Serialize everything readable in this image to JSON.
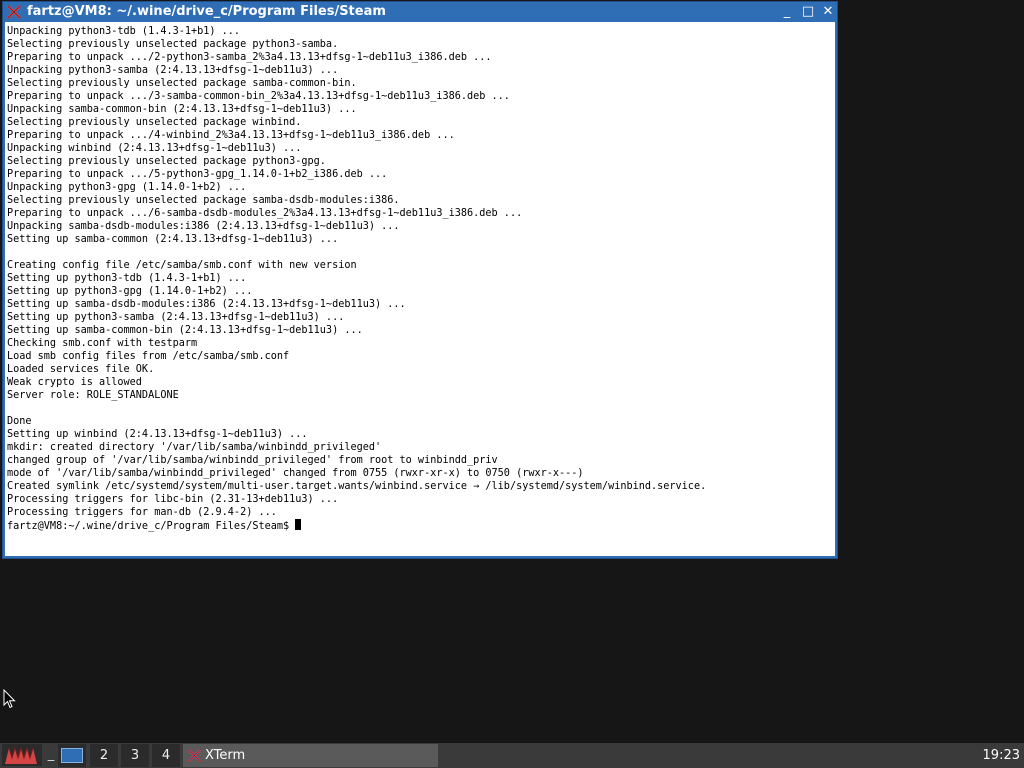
{
  "window": {
    "title": "fartz@VM8: ~/.wine/drive_c/Program Files/Steam",
    "buttons": {
      "minimize": "_",
      "maximize": "□",
      "close": "✕"
    }
  },
  "terminal": {
    "lines": [
      "Unpacking python3-tdb (1.4.3-1+b1) ...",
      "Selecting previously unselected package python3-samba.",
      "Preparing to unpack .../2-python3-samba_2%3a4.13.13+dfsg-1~deb11u3_i386.deb ...",
      "Unpacking python3-samba (2:4.13.13+dfsg-1~deb11u3) ...",
      "Selecting previously unselected package samba-common-bin.",
      "Preparing to unpack .../3-samba-common-bin_2%3a4.13.13+dfsg-1~deb11u3_i386.deb ...",
      "Unpacking samba-common-bin (2:4.13.13+dfsg-1~deb11u3) ...",
      "Selecting previously unselected package winbind.",
      "Preparing to unpack .../4-winbind_2%3a4.13.13+dfsg-1~deb11u3_i386.deb ...",
      "Unpacking winbind (2:4.13.13+dfsg-1~deb11u3) ...",
      "Selecting previously unselected package python3-gpg.",
      "Preparing to unpack .../5-python3-gpg_1.14.0-1+b2_i386.deb ...",
      "Unpacking python3-gpg (1.14.0-1+b2) ...",
      "Selecting previously unselected package samba-dsdb-modules:i386.",
      "Preparing to unpack .../6-samba-dsdb-modules_2%3a4.13.13+dfsg-1~deb11u3_i386.deb ...",
      "Unpacking samba-dsdb-modules:i386 (2:4.13.13+dfsg-1~deb11u3) ...",
      "Setting up samba-common (2:4.13.13+dfsg-1~deb11u3) ...",
      "",
      "Creating config file /etc/samba/smb.conf with new version",
      "Setting up python3-tdb (1.4.3-1+b1) ...",
      "Setting up python3-gpg (1.14.0-1+b2) ...",
      "Setting up samba-dsdb-modules:i386 (2:4.13.13+dfsg-1~deb11u3) ...",
      "Setting up python3-samba (2:4.13.13+dfsg-1~deb11u3) ...",
      "Setting up samba-common-bin (2:4.13.13+dfsg-1~deb11u3) ...",
      "Checking smb.conf with testparm",
      "Load smb config files from /etc/samba/smb.conf",
      "Loaded services file OK.",
      "Weak crypto is allowed",
      "Server role: ROLE_STANDALONE",
      "",
      "Done",
      "Setting up winbind (2:4.13.13+dfsg-1~deb11u3) ...",
      "mkdir: created directory '/var/lib/samba/winbindd_privileged'",
      "changed group of '/var/lib/samba/winbindd_privileged' from root to winbindd_priv",
      "mode of '/var/lib/samba/winbindd_privileged' changed from 0755 (rwxr-xr-x) to 0750 (rwxr-x---)",
      "Created symlink /etc/systemd/system/multi-user.target.wants/winbind.service → /lib/systemd/system/winbind.service.",
      "Processing triggers for libc-bin (2.31-13+deb11u3) ...",
      "Processing triggers for man-db (2.9.4-2) ..."
    ],
    "prompt": "fartz@VM8:~/.wine/drive_c/Program Files/Steam$ "
  },
  "taskbar": {
    "launcher": "_",
    "workspaces": [
      "2",
      "3",
      "4"
    ],
    "task_label": "XTerm",
    "clock": "19:23"
  },
  "colors": {
    "titlebar": "#2f6db5",
    "terminal_bg": "#ffffff",
    "desktop": "#161616",
    "taskbar": "#3a3a3a"
  }
}
